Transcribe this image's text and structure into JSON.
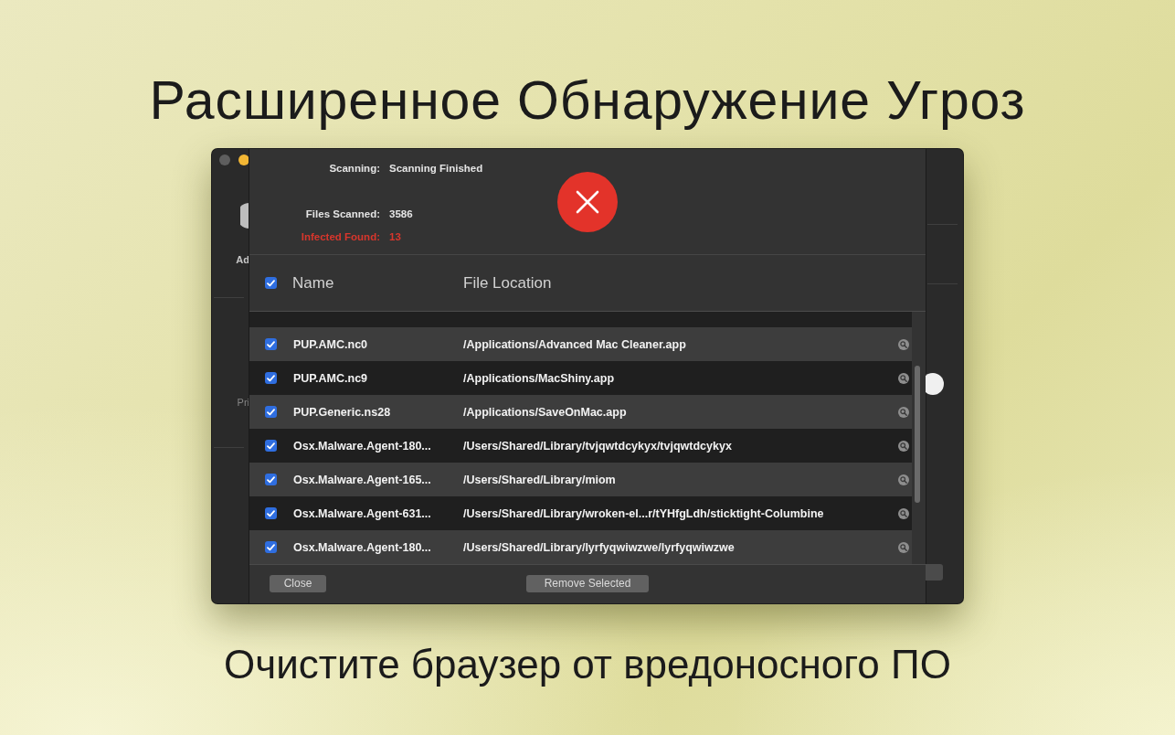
{
  "headline": "Расширенное Обнаружение Угроз",
  "background_window": {
    "sidebar": {
      "item_label": "Ad",
      "section_label": "Pri"
    }
  },
  "scan_dialog": {
    "status": {
      "label": "Scanning:",
      "value": "Scanning Finished"
    },
    "counts": [
      {
        "label": "Files Scanned:",
        "value": "3586",
        "kind": "normal"
      },
      {
        "label": "Infected Found:",
        "value": "13",
        "kind": "alert"
      }
    ],
    "table": {
      "all_checked": true,
      "columns": [
        "Name",
        "File Location"
      ],
      "rows": [
        {
          "name": "PUP.AMC.nc0",
          "location": "/Applications/Advanced Mac Cleaner.app",
          "checked": true
        },
        {
          "name": "PUP.AMC.nc9",
          "location": "/Applications/MacShiny.app",
          "checked": true
        },
        {
          "name": "PUP.Generic.ns28",
          "location": "/Applications/SaveOnMac.app",
          "checked": true
        },
        {
          "name": "Osx.Malware.Agent-180...",
          "location": "/Users/Shared/Library/tvjqwtdcykyx/tvjqwtdcykyx",
          "checked": true
        },
        {
          "name": "Osx.Malware.Agent-165...",
          "location": "/Users/Shared/Library/miom",
          "checked": true
        },
        {
          "name": "Osx.Malware.Agent-631...",
          "location": "/Users/Shared/Library/wroken-el...r/tYHfgLdh/sticktight-Columbine",
          "checked": true
        },
        {
          "name": "Osx.Malware.Agent-180...",
          "location": "/Users/Shared/Library/lyrfyqwiwzwe/lyrfyqwiwzwe",
          "checked": true
        }
      ]
    },
    "buttons": [
      {
        "label": "Close"
      },
      {
        "label": "Remove Selected"
      }
    ]
  },
  "caption": "Очистите браузер от вредоносного ПО"
}
